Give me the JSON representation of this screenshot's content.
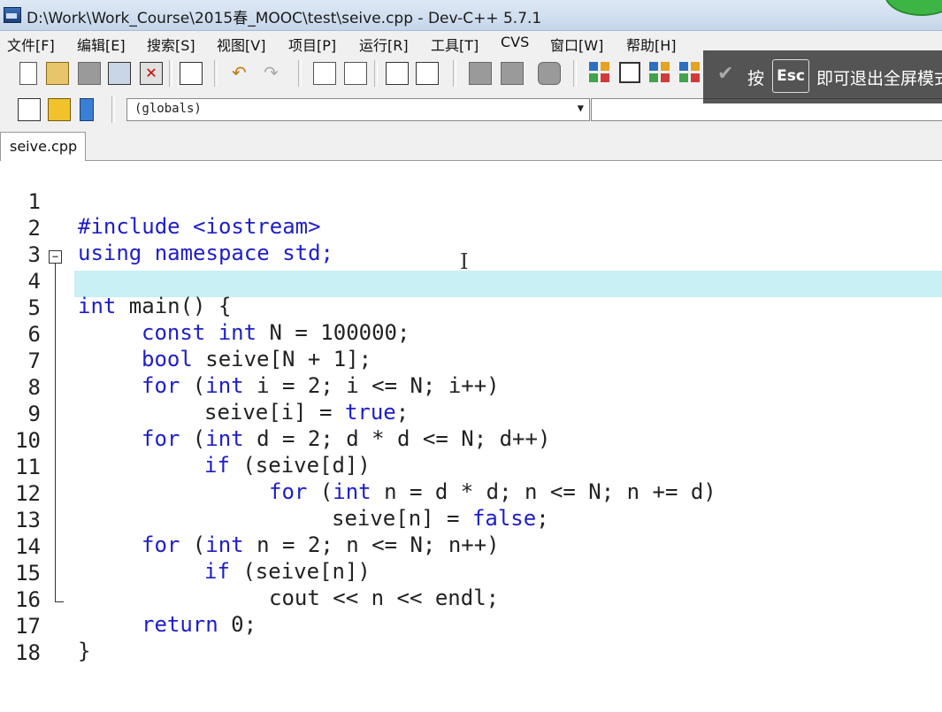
{
  "window": {
    "title": "D:\\Work\\Work_Course\\2015春_MOOC\\test\\seive.cpp - Dev-C++ 5.7.1"
  },
  "menu": [
    "文件[F]",
    "编辑[E]",
    "搜索[S]",
    "视图[V]",
    "项目[P]",
    "运行[R]",
    "工具[T]",
    "CVS",
    "窗口[W]",
    "帮助[H]"
  ],
  "toolbar": {
    "scope_select": "(globals)"
  },
  "fullscreen_notice": {
    "press": "按",
    "key": "Esc",
    "message": "即可退出全屏模式"
  },
  "tabs": [
    {
      "label": "seive.cpp"
    }
  ],
  "editor": {
    "lines": [
      {
        "n": "1"
      },
      {
        "n": "2"
      },
      {
        "n": "3"
      },
      {
        "n": "4"
      },
      {
        "n": "5"
      },
      {
        "n": "6"
      },
      {
        "n": "7"
      },
      {
        "n": "8"
      },
      {
        "n": "9"
      },
      {
        "n": "10"
      },
      {
        "n": "11"
      },
      {
        "n": "12"
      },
      {
        "n": "13"
      },
      {
        "n": "14"
      },
      {
        "n": "15"
      },
      {
        "n": "16"
      },
      {
        "n": "17"
      },
      {
        "n": "18"
      }
    ],
    "code": {
      "l1": "#include <iostream>",
      "l2": "using namespace std;",
      "l4a": "int",
      "l4b": " main() {",
      "l5a": "const",
      "l5b": " ",
      "l5c": "int",
      "l5d": " N = 100000;",
      "l6a": "bool",
      "l6b": " seive[N + 1];",
      "l7a": "for",
      "l7b": " (",
      "l7c": "int",
      "l7d": " i = 2; i <= N; i++)",
      "l8a": "seive[i] = ",
      "l8b": "true",
      "l8c": ";",
      "l9a": "for",
      "l9b": " (",
      "l9c": "int",
      "l9d": " d = 2; d * d <= N; d++)",
      "l10a": "if",
      "l10b": " (seive[d])",
      "l11a": "for",
      "l11b": " (",
      "l11c": "int",
      "l11d": " n = d * d; n <= N; n += d)",
      "l12a": "seive[n] = ",
      "l12b": "false",
      "l12c": ";",
      "l13a": "for",
      "l13b": " (",
      "l13c": "int",
      "l13d": " n = 2; n <= N; n++)",
      "l14a": "if",
      "l14b": " (seive[n])",
      "l15": "cout << n << endl;",
      "l16a": "return",
      "l16b": " 0;",
      "l17": "}"
    }
  }
}
